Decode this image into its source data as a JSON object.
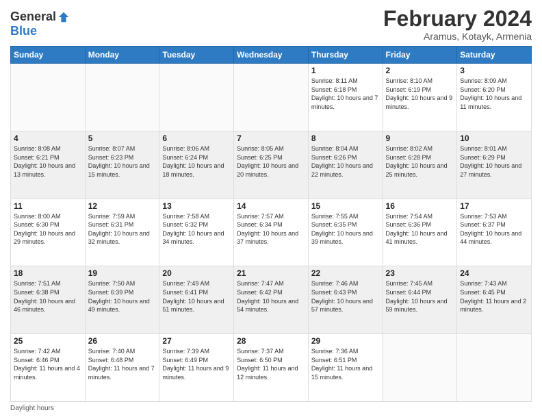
{
  "logo": {
    "general": "General",
    "blue": "Blue"
  },
  "header": {
    "month": "February 2024",
    "location": "Aramus, Kotayk, Armenia"
  },
  "days_of_week": [
    "Sunday",
    "Monday",
    "Tuesday",
    "Wednesday",
    "Thursday",
    "Friday",
    "Saturday"
  ],
  "weeks": [
    [
      {
        "day": "",
        "info": ""
      },
      {
        "day": "",
        "info": ""
      },
      {
        "day": "",
        "info": ""
      },
      {
        "day": "",
        "info": ""
      },
      {
        "day": "1",
        "info": "Sunrise: 8:11 AM\nSunset: 6:18 PM\nDaylight: 10 hours and 7 minutes."
      },
      {
        "day": "2",
        "info": "Sunrise: 8:10 AM\nSunset: 6:19 PM\nDaylight: 10 hours and 9 minutes."
      },
      {
        "day": "3",
        "info": "Sunrise: 8:09 AM\nSunset: 6:20 PM\nDaylight: 10 hours and 11 minutes."
      }
    ],
    [
      {
        "day": "4",
        "info": "Sunrise: 8:08 AM\nSunset: 6:21 PM\nDaylight: 10 hours and 13 minutes."
      },
      {
        "day": "5",
        "info": "Sunrise: 8:07 AM\nSunset: 6:23 PM\nDaylight: 10 hours and 15 minutes."
      },
      {
        "day": "6",
        "info": "Sunrise: 8:06 AM\nSunset: 6:24 PM\nDaylight: 10 hours and 18 minutes."
      },
      {
        "day": "7",
        "info": "Sunrise: 8:05 AM\nSunset: 6:25 PM\nDaylight: 10 hours and 20 minutes."
      },
      {
        "day": "8",
        "info": "Sunrise: 8:04 AM\nSunset: 6:26 PM\nDaylight: 10 hours and 22 minutes."
      },
      {
        "day": "9",
        "info": "Sunrise: 8:02 AM\nSunset: 6:28 PM\nDaylight: 10 hours and 25 minutes."
      },
      {
        "day": "10",
        "info": "Sunrise: 8:01 AM\nSunset: 6:29 PM\nDaylight: 10 hours and 27 minutes."
      }
    ],
    [
      {
        "day": "11",
        "info": "Sunrise: 8:00 AM\nSunset: 6:30 PM\nDaylight: 10 hours and 29 minutes."
      },
      {
        "day": "12",
        "info": "Sunrise: 7:59 AM\nSunset: 6:31 PM\nDaylight: 10 hours and 32 minutes."
      },
      {
        "day": "13",
        "info": "Sunrise: 7:58 AM\nSunset: 6:32 PM\nDaylight: 10 hours and 34 minutes."
      },
      {
        "day": "14",
        "info": "Sunrise: 7:57 AM\nSunset: 6:34 PM\nDaylight: 10 hours and 37 minutes."
      },
      {
        "day": "15",
        "info": "Sunrise: 7:55 AM\nSunset: 6:35 PM\nDaylight: 10 hours and 39 minutes."
      },
      {
        "day": "16",
        "info": "Sunrise: 7:54 AM\nSunset: 6:36 PM\nDaylight: 10 hours and 41 minutes."
      },
      {
        "day": "17",
        "info": "Sunrise: 7:53 AM\nSunset: 6:37 PM\nDaylight: 10 hours and 44 minutes."
      }
    ],
    [
      {
        "day": "18",
        "info": "Sunrise: 7:51 AM\nSunset: 6:38 PM\nDaylight: 10 hours and 46 minutes."
      },
      {
        "day": "19",
        "info": "Sunrise: 7:50 AM\nSunset: 6:39 PM\nDaylight: 10 hours and 49 minutes."
      },
      {
        "day": "20",
        "info": "Sunrise: 7:49 AM\nSunset: 6:41 PM\nDaylight: 10 hours and 51 minutes."
      },
      {
        "day": "21",
        "info": "Sunrise: 7:47 AM\nSunset: 6:42 PM\nDaylight: 10 hours and 54 minutes."
      },
      {
        "day": "22",
        "info": "Sunrise: 7:46 AM\nSunset: 6:43 PM\nDaylight: 10 hours and 57 minutes."
      },
      {
        "day": "23",
        "info": "Sunrise: 7:45 AM\nSunset: 6:44 PM\nDaylight: 10 hours and 59 minutes."
      },
      {
        "day": "24",
        "info": "Sunrise: 7:43 AM\nSunset: 6:45 PM\nDaylight: 11 hours and 2 minutes."
      }
    ],
    [
      {
        "day": "25",
        "info": "Sunrise: 7:42 AM\nSunset: 6:46 PM\nDaylight: 11 hours and 4 minutes."
      },
      {
        "day": "26",
        "info": "Sunrise: 7:40 AM\nSunset: 6:48 PM\nDaylight: 11 hours and 7 minutes."
      },
      {
        "day": "27",
        "info": "Sunrise: 7:39 AM\nSunset: 6:49 PM\nDaylight: 11 hours and 9 minutes."
      },
      {
        "day": "28",
        "info": "Sunrise: 7:37 AM\nSunset: 6:50 PM\nDaylight: 11 hours and 12 minutes."
      },
      {
        "day": "29",
        "info": "Sunrise: 7:36 AM\nSunset: 6:51 PM\nDaylight: 11 hours and 15 minutes."
      },
      {
        "day": "",
        "info": ""
      },
      {
        "day": "",
        "info": ""
      }
    ]
  ],
  "footer": {
    "daylight_hours": "Daylight hours"
  }
}
